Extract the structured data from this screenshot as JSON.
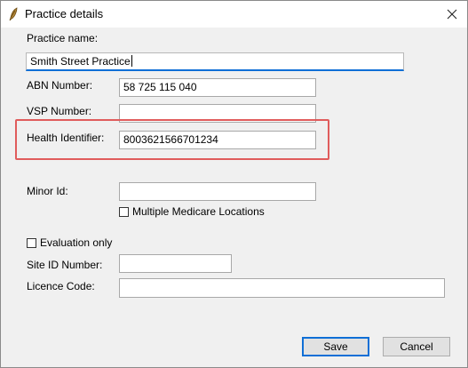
{
  "window": {
    "title": "Practice details",
    "close_glyph": "✕"
  },
  "form": {
    "practice_name_label": "Practice name:",
    "practice_name_value": "Smith Street Practice",
    "abn_label": "ABN Number:",
    "abn_value": "58 725 115 040",
    "vsp_label": "VSP Number:",
    "vsp_value": "",
    "health_identifier_label": "Health Identifier:",
    "health_identifier_value": "8003621566701234",
    "minor_id_label": "Minor Id:",
    "minor_id_value": "",
    "multiple_medicare_label": "Multiple Medicare Locations",
    "multiple_medicare_checked": false,
    "evaluation_only_label": "Evaluation only",
    "evaluation_only_checked": false,
    "site_id_label": "Site ID Number:",
    "site_id_value": "",
    "licence_code_label": "Licence Code:",
    "licence_code_value": ""
  },
  "buttons": {
    "save_label": "Save",
    "cancel_label": "Cancel"
  },
  "colors": {
    "highlight_border": "#e05c5c",
    "focus_accent": "#0f6fd6"
  },
  "icons": {
    "app_icon": "quill-pen-icon",
    "close_icon": "close-icon"
  }
}
